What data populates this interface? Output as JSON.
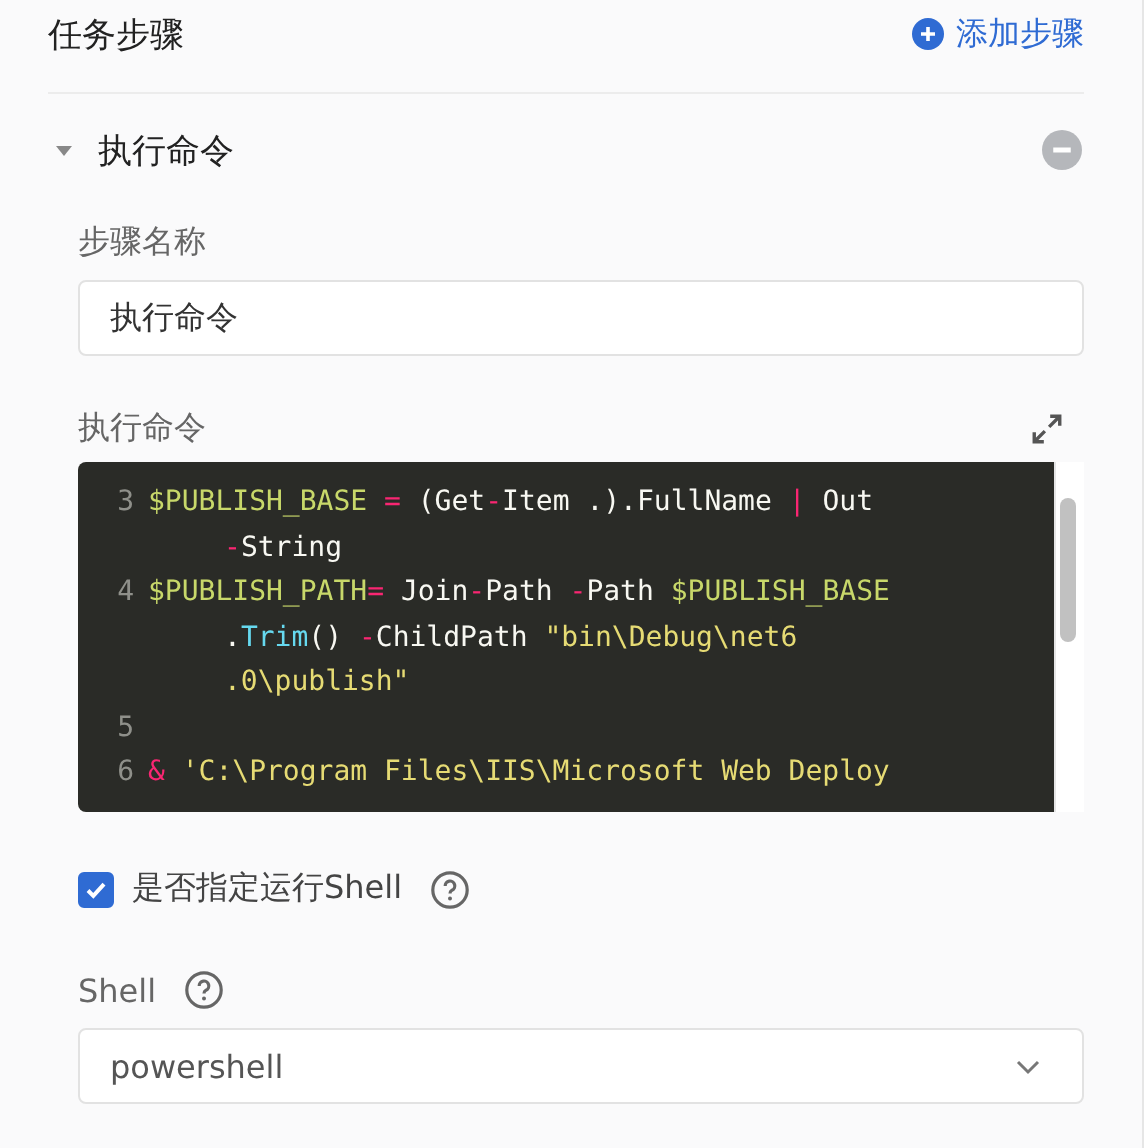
{
  "header": {
    "title": "任务步骤",
    "add_link": "添加步骤"
  },
  "step": {
    "title": "执行命令",
    "expanded": true,
    "name_field": {
      "label": "步骤名称",
      "value": "执行命令"
    },
    "command": {
      "label": "执行命令",
      "lines": [
        {
          "number": "3",
          "wraps": [
            {
              "segments": [
                {
                  "kind": "var",
                  "text": "$PUBLISH_BASE "
                },
                {
                  "kind": "op",
                  "text": "="
                },
                {
                  "kind": "plain",
                  "text": " (Get"
                },
                {
                  "kind": "op",
                  "text": "-"
                },
                {
                  "kind": "plain",
                  "text": "Item .).FullName "
                },
                {
                  "kind": "op",
                  "text": "|"
                },
                {
                  "kind": "plain",
                  "text": " Out"
                }
              ]
            },
            {
              "segments": [
                {
                  "kind": "op",
                  "text": "-"
                },
                {
                  "kind": "plain",
                  "text": "String"
                }
              ]
            }
          ]
        },
        {
          "number": "4",
          "wraps": [
            {
              "segments": [
                {
                  "kind": "var",
                  "text": "$PUBLISH_PATH"
                },
                {
                  "kind": "op",
                  "text": "="
                },
                {
                  "kind": "plain",
                  "text": " Join"
                },
                {
                  "kind": "op",
                  "text": "-"
                },
                {
                  "kind": "plain",
                  "text": "Path "
                },
                {
                  "kind": "op",
                  "text": "-"
                },
                {
                  "kind": "plain",
                  "text": "Path "
                },
                {
                  "kind": "var",
                  "text": "$PUBLISH_BASE"
                }
              ]
            },
            {
              "segments": [
                {
                  "kind": "plain",
                  "text": "."
                },
                {
                  "kind": "func",
                  "text": "Trim"
                },
                {
                  "kind": "plain",
                  "text": "() "
                },
                {
                  "kind": "op",
                  "text": "-"
                },
                {
                  "kind": "plain",
                  "text": "ChildPath "
                },
                {
                  "kind": "string",
                  "text": "\"bin\\Debug\\net6"
                }
              ]
            },
            {
              "segments": [
                {
                  "kind": "string",
                  "text": ".0\\publish\""
                }
              ]
            }
          ]
        },
        {
          "number": "5"
        },
        {
          "number": "6",
          "wraps": [
            {
              "segments": [
                {
                  "kind": "op",
                  "text": "& "
                },
                {
                  "kind": "string",
                  "text": "'C:\\Program Files\\IIS\\Microsoft Web Deploy"
                }
              ]
            }
          ]
        }
      ]
    },
    "shell_toggle": {
      "label": "是否指定运行Shell",
      "checked": true
    },
    "shell": {
      "label": "Shell",
      "value": "powershell"
    }
  }
}
